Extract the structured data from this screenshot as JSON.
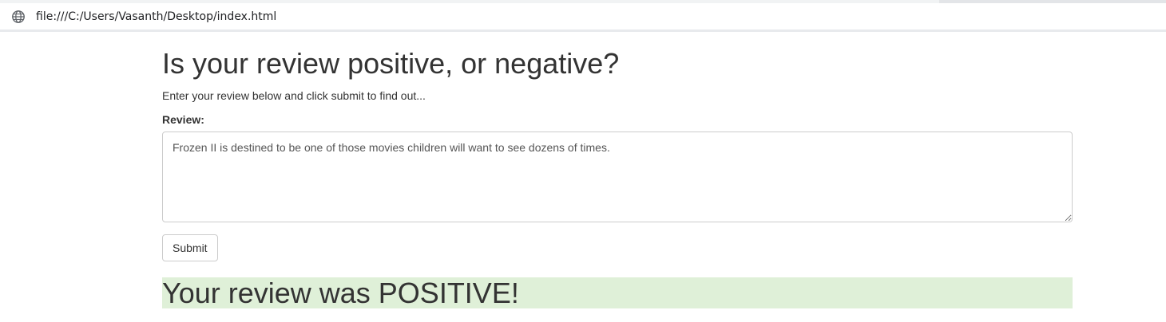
{
  "browser": {
    "url": "file:///C:/Users/Vasanth/Desktop/index.html",
    "url_icon": "globe-icon"
  },
  "page": {
    "title": "Is your review positive, or negative?",
    "subtitle": "Enter your review below and click submit to find out...",
    "review_label": "Review:",
    "review_text": "Frozen II is destined to be one of those movies children will want to see dozens of times.",
    "submit_label": "Submit",
    "result_text": "Your review was POSITIVE!",
    "result_background": "#dff0d8"
  }
}
